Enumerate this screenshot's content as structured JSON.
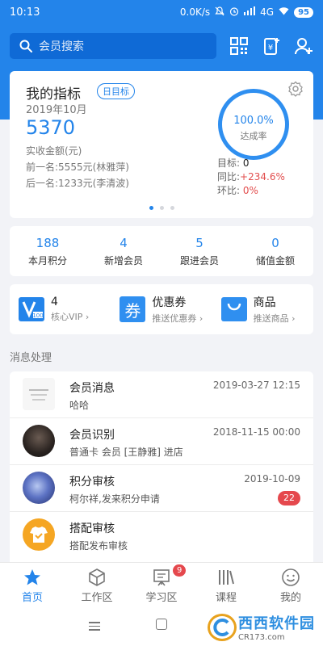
{
  "status_bar": {
    "time": "10:13",
    "speed": "0.0K/s",
    "network": "4G",
    "battery": "95"
  },
  "search": {
    "placeholder": "会员搜索"
  },
  "metrics": {
    "title": "我的指标",
    "tag": "日目标",
    "date": "2019年10月",
    "value": "5370",
    "value_label": "实收金额(元)",
    "prev": "前一名:5555元(林雅萍)",
    "next": "后一名:1233元(李清波)",
    "rate": "100.0%",
    "rate_label": "达成率",
    "target_label": "目标:",
    "target_value": "0",
    "yoy_label": "同比:",
    "yoy_value": "+234.6%",
    "mom_label": "环比:",
    "mom_value": "0%"
  },
  "stats": [
    {
      "value": "188",
      "label": "本月积分"
    },
    {
      "value": "4",
      "label": "新增会员"
    },
    {
      "value": "5",
      "label": "跟进会员"
    },
    {
      "value": "0",
      "label": "储值金额"
    }
  ],
  "quick": {
    "vip": {
      "title": "4",
      "sub": "核心VIP ›",
      "icon_text": "V"
    },
    "coupon": {
      "title": "优惠券",
      "sub": "推送优惠券 ›",
      "icon_text": "券"
    },
    "goods": {
      "title": "商品",
      "sub": "推送商品 ›"
    }
  },
  "section_title": "消息处理",
  "messages": [
    {
      "title": "会员消息",
      "sub": "哈哈",
      "time": "2019-03-27 12:15"
    },
    {
      "title": "会员识别",
      "sub": "普通卡 会员 [王静雅] 进店",
      "time": "2018-11-15 00:00"
    },
    {
      "title": "积分审核",
      "sub": "柯尔祥,发来积分申请",
      "time": "2019-10-09",
      "badge": "22"
    },
    {
      "title": "搭配审核",
      "sub": "搭配发布审核",
      "time": ""
    }
  ],
  "tabs": [
    {
      "label": "首页"
    },
    {
      "label": "工作区"
    },
    {
      "label": "学习区",
      "badge": "9"
    },
    {
      "label": "课程"
    },
    {
      "label": "我的"
    }
  ],
  "watermark": {
    "name": "西西软件园",
    "url": "CR173.com"
  },
  "colors": {
    "primary": "#2384ea",
    "danger": "#e5484d"
  }
}
